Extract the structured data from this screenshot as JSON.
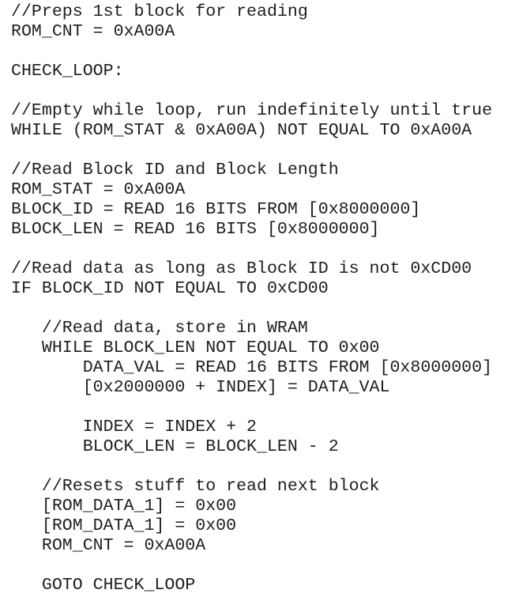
{
  "code_lines": [
    "//Preps 1st block for reading",
    "ROM_CNT = 0xA00A",
    "",
    "CHECK_LOOP:",
    "",
    "//Empty while loop, run indefinitely until true",
    "WHILE (ROM_STAT & 0xA00A) NOT EQUAL TO 0xA00A",
    "",
    "//Read Block ID and Block Length",
    "ROM_STAT = 0xA00A",
    "BLOCK_ID = READ 16 BITS FROM [0x8000000]",
    "BLOCK_LEN = READ 16 BITS [0x8000000]",
    "",
    "//Read data as long as Block ID is not 0xCD00",
    "IF BLOCK_ID NOT EQUAL TO 0xCD00",
    "",
    "   //Read data, store in WRAM",
    "   WHILE BLOCK_LEN NOT EQUAL TO 0x00",
    "       DATA_VAL = READ 16 BITS FROM [0x8000000]",
    "       [0x2000000 + INDEX] = DATA_VAL",
    "",
    "       INDEX = INDEX + 2",
    "       BLOCK_LEN = BLOCK_LEN - 2",
    "",
    "   //Resets stuff to read next block",
    "   [ROM_DATA_1] = 0x00",
    "   [ROM_DATA_1] = 0x00",
    "   ROM_CNT = 0xA00A",
    "",
    "   GOTO CHECK_LOOP"
  ]
}
